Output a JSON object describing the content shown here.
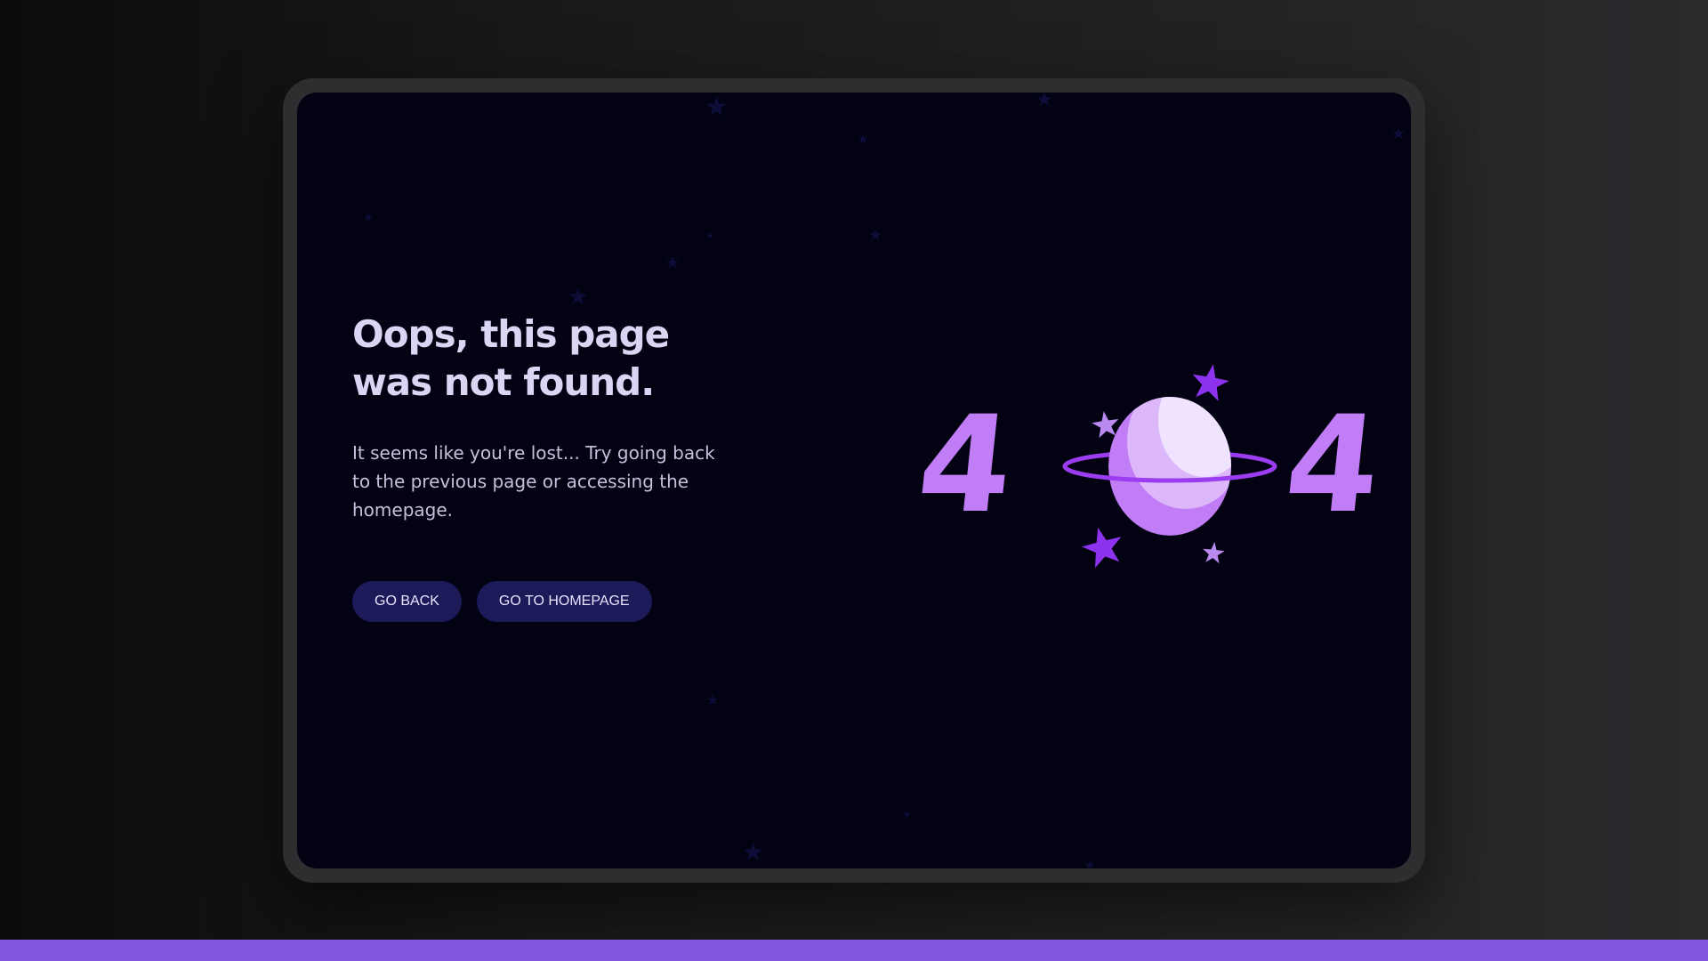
{
  "error": {
    "title": "Oops, this page was not found.",
    "description": "It seems like you're lost... Try going back to the previous page or accessing the homepage.",
    "code": "404",
    "code_left": "4",
    "code_right": "4"
  },
  "actions": {
    "back_label": "GO BACK",
    "home_label": "GO TO HOMEPAGE"
  },
  "illustration": {
    "icon": "planet-icon",
    "decorations": [
      "star-icon"
    ]
  },
  "colors": {
    "background": "#020213",
    "accent": "#8256df",
    "digits": "#c17df5",
    "planet_light": "#eedfff",
    "planet_dark": "#c17df5",
    "ring": "#9b3cf0",
    "star": "#8d33ee",
    "button": "#1c1a58",
    "heading": "#d9d6f4"
  }
}
